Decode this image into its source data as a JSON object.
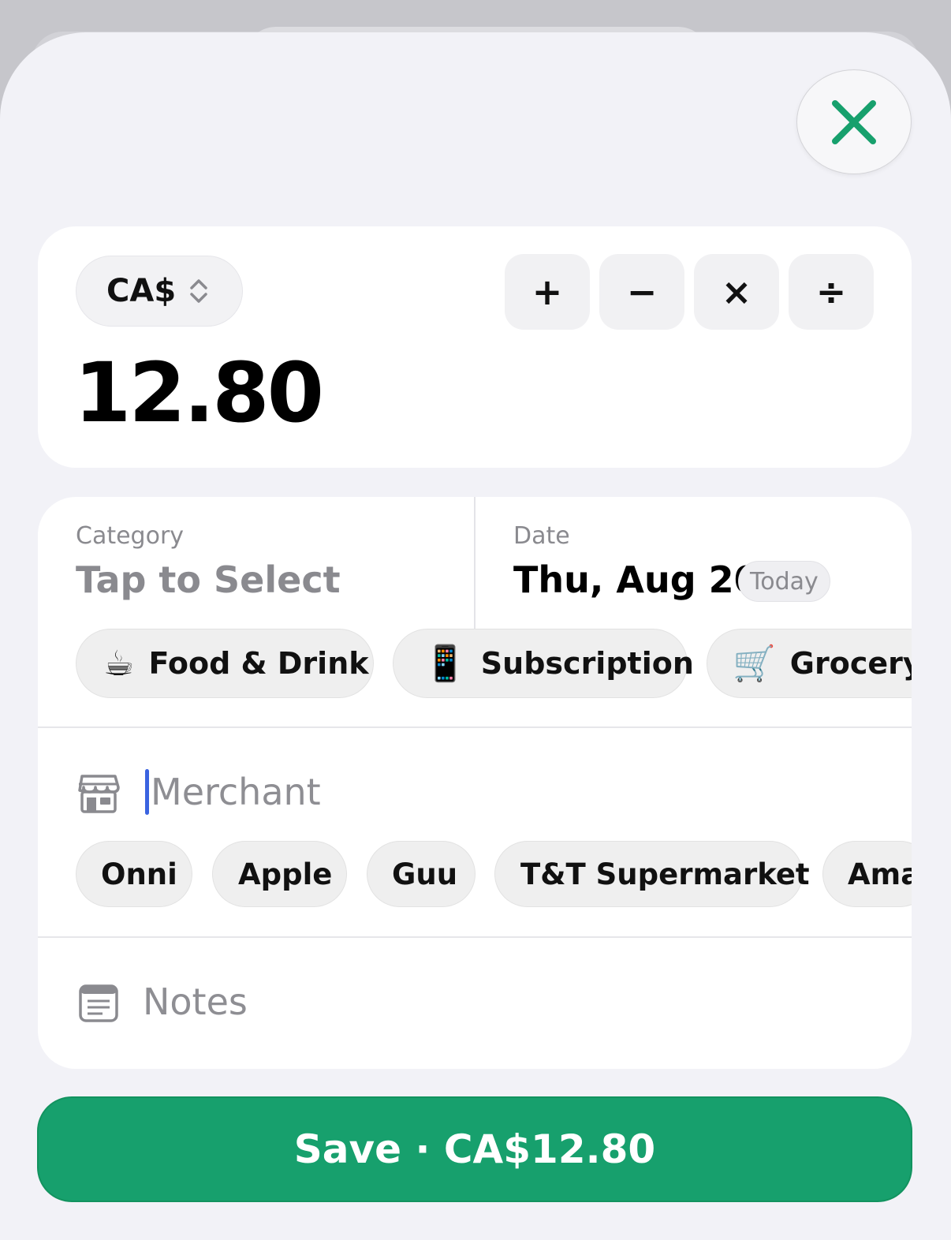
{
  "header": {
    "close_icon": "xmark-icon",
    "accent_color": "#17a06d"
  },
  "amount_card": {
    "currency": "CA$",
    "currency_icon": "chevron-up-down-icon",
    "operators": [
      "+",
      "−",
      "×",
      "÷"
    ],
    "amount": "12.80"
  },
  "category": {
    "label": "Category",
    "value": "Tap to Select"
  },
  "date": {
    "label": "Date",
    "value": "Thu, Aug 20",
    "badge": "Today"
  },
  "category_chips": [
    {
      "emoji": "☕",
      "label": "Food & Drink"
    },
    {
      "emoji": "📱",
      "label": "Subscription"
    },
    {
      "emoji": "🛒",
      "label": "Grocery"
    }
  ],
  "merchant": {
    "icon": "storefront-icon",
    "placeholder": "Merchant"
  },
  "merchant_chips": [
    "Onni",
    "Apple",
    "Guu",
    "T&T Supermarket",
    "Ama"
  ],
  "notes": {
    "icon": "notes-icon",
    "placeholder": "Notes"
  },
  "save_button": {
    "label": "Save · CA$12.80"
  }
}
